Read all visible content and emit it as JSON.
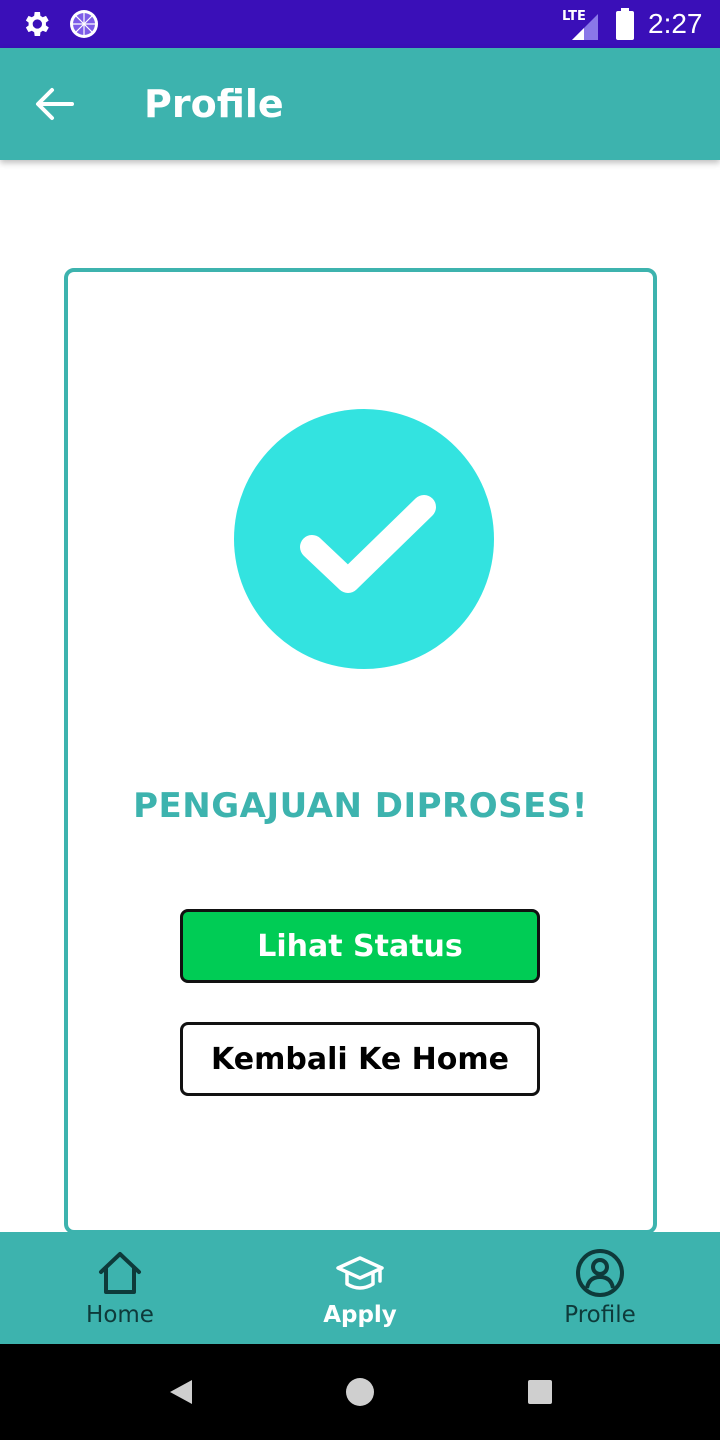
{
  "status_bar": {
    "time": "2:27",
    "network": "LTE",
    "icons": [
      "settings-icon",
      "dial-icon",
      "lte-signal-icon",
      "battery-icon"
    ]
  },
  "app_bar": {
    "title": "Profile",
    "back_icon": "back-arrow-icon"
  },
  "card": {
    "icon": "check-circle-icon",
    "message": "PENGAJUAN DIPROSES!",
    "primary_button": "Lihat Status",
    "secondary_button": "Kembali Ke Home"
  },
  "bottom_nav": {
    "items": [
      {
        "label": "Home",
        "icon": "home-icon",
        "active": false
      },
      {
        "label": "Apply",
        "icon": "graduation-cap-icon",
        "active": true
      },
      {
        "label": "Profile",
        "icon": "profile-icon",
        "active": false
      }
    ]
  },
  "system_nav": {
    "icons": [
      "back-triangle-icon",
      "home-circle-icon",
      "recents-square-icon"
    ]
  },
  "colors": {
    "status_bar": "#3a0fb8",
    "accent": "#3db3ae",
    "check_circle": "#33e3e0",
    "primary_button": "#00cc55"
  }
}
